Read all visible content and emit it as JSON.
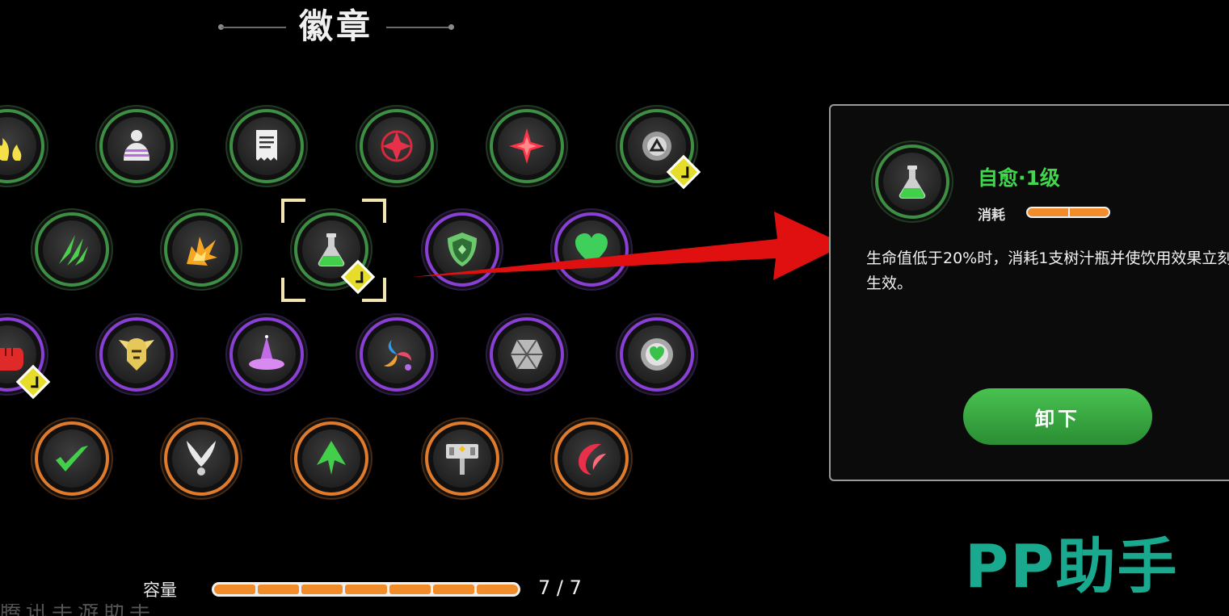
{
  "header": {
    "title": "徽章"
  },
  "badges": [
    {
      "name": "badge-flames",
      "ring": "green",
      "icon": "flames-icon"
    },
    {
      "name": "badge-silhouette",
      "ring": "green",
      "icon": "silhouette-icon"
    },
    {
      "name": "badge-receipt",
      "ring": "green",
      "icon": "receipt-icon"
    },
    {
      "name": "badge-red-star-circle",
      "ring": "green",
      "icon": "red-star-circle-icon"
    },
    {
      "name": "badge-red-star",
      "ring": "green",
      "icon": "red-star-icon"
    },
    {
      "name": "badge-triangle",
      "ring": "green",
      "icon": "triangle-icon",
      "equipped": true
    },
    {
      "name": "badge-claws",
      "ring": "green",
      "icon": "claws-icon"
    },
    {
      "name": "badge-explosion",
      "ring": "green",
      "icon": "explosion-icon"
    },
    {
      "name": "badge-potion",
      "ring": "green",
      "icon": "potion-icon",
      "equipped": true,
      "selected": true
    },
    {
      "name": "badge-shield",
      "ring": "purple",
      "icon": "shield-icon"
    },
    {
      "name": "badge-heart",
      "ring": "purple",
      "icon": "heart-icon"
    },
    {
      "name": "badge-fist",
      "ring": "purple",
      "icon": "fist-icon",
      "equipped": true
    },
    {
      "name": "badge-helmet",
      "ring": "purple",
      "icon": "helmet-icon"
    },
    {
      "name": "badge-hat",
      "ring": "purple",
      "icon": "hat-icon"
    },
    {
      "name": "badge-swirl",
      "ring": "purple",
      "icon": "swirl-icon"
    },
    {
      "name": "badge-crystal",
      "ring": "purple",
      "icon": "crystal-icon"
    },
    {
      "name": "badge-heart-coin",
      "ring": "purple",
      "icon": "heart-coin-icon"
    },
    {
      "name": "badge-check-arrow",
      "ring": "orange",
      "icon": "check-arrow-icon"
    },
    {
      "name": "badge-blades",
      "ring": "orange",
      "icon": "blades-icon"
    },
    {
      "name": "badge-arrow-up",
      "ring": "orange",
      "icon": "arrow-up-icon"
    },
    {
      "name": "badge-hammer",
      "ring": "orange",
      "icon": "hammer-icon"
    },
    {
      "name": "badge-crescent",
      "ring": "orange",
      "icon": "crescent-icon"
    }
  ],
  "detail": {
    "name": "自愈·1级",
    "cost_label": "消耗",
    "cost_level": 2,
    "description": "生命值低于20%时，消耗1支树汁瓶并使饮用效果立刻生效。",
    "unequip_label": "卸下"
  },
  "capacity": {
    "label": "容量",
    "used": 7,
    "total": 7,
    "count_text": "7 / 7"
  },
  "bottom_text": "腾讯手游助手",
  "watermark": "PP助手",
  "colors": {
    "ring_green": "#3d8f43",
    "ring_purple": "#8a3fd6",
    "ring_orange": "#e17b2c",
    "name_green": "#41d64b",
    "equipped_yellow": "#e6dd2a",
    "bar_orange": "#f08c2a",
    "arrow_red": "#e01010",
    "watermark_teal": "#18a98f"
  }
}
